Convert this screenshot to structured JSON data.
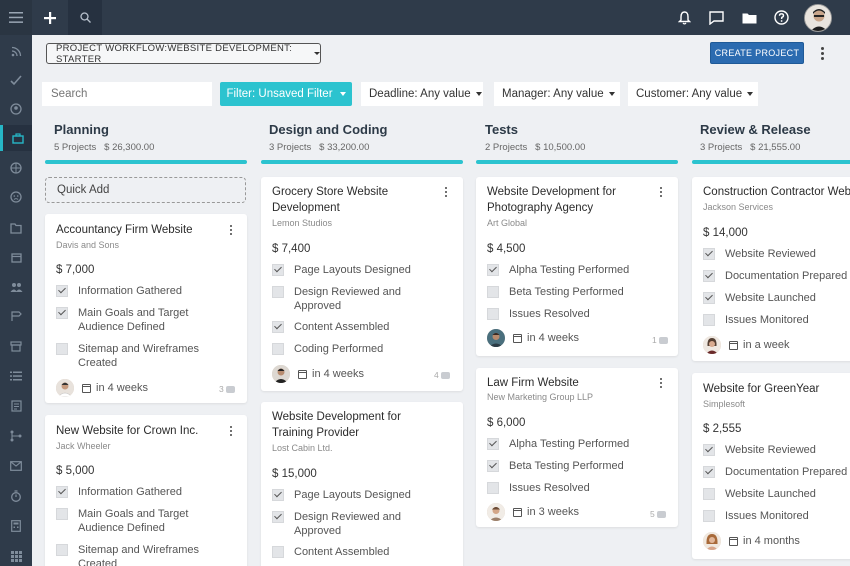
{
  "header": {
    "icons": [
      "hamburger-menu-icon",
      "plus-icon",
      "search-icon",
      "bell-icon",
      "chat-icon",
      "folder-icon",
      "help-icon",
      "user-avatar"
    ]
  },
  "sidebar": {
    "icons": [
      "feed-icon",
      "tasks-icon",
      "contacts-icon",
      "projects-icon",
      "globe-icon",
      "emoji-icon",
      "files-icon",
      "calendar-icon",
      "team-icon",
      "timeline-icon",
      "archive-icon",
      "list-icon",
      "reports-icon",
      "workflow-icon",
      "mail-icon",
      "timer-icon",
      "calculator-icon",
      "apps-icon"
    ],
    "active_index": 3
  },
  "toolbar": {
    "workflow_label": "PROJECT WORKFLOW:WEBSITE DEVELOPMENT: STARTER",
    "create_label": "CREATE PROJECT"
  },
  "filters": {
    "search_placeholder": "Search",
    "filter_label": "Filter: Unsaved Filter",
    "deadline": "Deadline: Any value",
    "manager": "Manager: Any value",
    "customer": "Customer: Any value"
  },
  "quick_add": "Quick Add",
  "columns": [
    {
      "title": "Planning",
      "count": "5 Projects",
      "amount": "$ 26,300.00",
      "cards": [
        {
          "title": "Accountancy Firm Website",
          "customer": "Davis and Sons",
          "price": "$ 7,000",
          "tasks": [
            {
              "label": "Information Gathered",
              "checked": true
            },
            {
              "label": "Main Goals and Target\nAudience Defined",
              "checked": true
            },
            {
              "label": "Sitemap and Wireframes\nCreated",
              "checked": false
            }
          ],
          "due": "in 4 weeks",
          "comments": "3"
        },
        {
          "title": "New Website for Crown Inc.",
          "customer": "Jack Wheeler",
          "price": "$ 5,000",
          "tasks": [
            {
              "label": "Information Gathered",
              "checked": true
            },
            {
              "label": "Main Goals and Target\nAudience Defined",
              "checked": false
            },
            {
              "label": "Sitemap and Wireframes\nCreated",
              "checked": false
            }
          ]
        }
      ]
    },
    {
      "title": "Design and Coding",
      "count": "3 Projects",
      "amount": "$ 33,200.00",
      "cards": [
        {
          "title": "Grocery Store Website\nDevelopment",
          "customer": "Lemon Studios",
          "price": "$ 7,400",
          "tasks": [
            {
              "label": "Page Layouts Designed",
              "checked": true
            },
            {
              "label": "Design Reviewed and\nApproved",
              "checked": false
            },
            {
              "label": "Content Assembled",
              "checked": true
            },
            {
              "label": "Coding Performed",
              "checked": false
            }
          ],
          "due": "in 4 weeks",
          "comments": "4"
        },
        {
          "title": "Website Development for\nTraining Provider",
          "customer": "Lost Cabin Ltd.",
          "price": "$ 15,000",
          "tasks": [
            {
              "label": "Page Layouts Designed",
              "checked": true
            },
            {
              "label": "Design Reviewed and\nApproved",
              "checked": true
            },
            {
              "label": "Content Assembled",
              "checked": false
            }
          ]
        }
      ]
    },
    {
      "title": "Tests",
      "count": "2 Projects",
      "amount": "$ 10,500.00",
      "cards": [
        {
          "title": "Website Development for\nPhotography Agency",
          "customer": "Art Global",
          "price": "$ 4,500",
          "tasks": [
            {
              "label": "Alpha Testing Performed",
              "checked": true
            },
            {
              "label": "Beta Testing Performed",
              "checked": false
            },
            {
              "label": "Issues Resolved",
              "checked": false
            }
          ],
          "due": "in 4 weeks",
          "comments": "1"
        },
        {
          "title": "Law Firm Website",
          "customer": "New Marketing Group LLP",
          "price": "$ 6,000",
          "tasks": [
            {
              "label": "Alpha Testing Performed",
              "checked": true
            },
            {
              "label": "Beta Testing Performed",
              "checked": true
            },
            {
              "label": "Issues Resolved",
              "checked": false
            }
          ],
          "due": "in 3 weeks",
          "comments": "5"
        }
      ]
    },
    {
      "title": "Review & Release",
      "count": "3 Projects",
      "amount": "$ 21,555.00",
      "cards": [
        {
          "title": "Construction Contractor Website",
          "customer": "Jackson Services",
          "price": "$ 14,000",
          "tasks": [
            {
              "label": "Website Reviewed",
              "checked": true
            },
            {
              "label": "Documentation Prepared",
              "checked": true
            },
            {
              "label": "Website Launched",
              "checked": true
            },
            {
              "label": "Issues Monitored",
              "checked": false
            }
          ],
          "due": "in a week"
        },
        {
          "title": "Website for GreenYear",
          "customer": "Simplesoft",
          "price": "$ 2,555",
          "tasks": [
            {
              "label": "Website Reviewed",
              "checked": true
            },
            {
              "label": "Documentation Prepared",
              "checked": true
            },
            {
              "label": "Website Launched",
              "checked": false
            },
            {
              "label": "Issues Monitored",
              "checked": false
            }
          ],
          "due": "in 4 months"
        }
      ]
    }
  ],
  "colors": {
    "topbar": "#2f3b4a",
    "accent": "#2cc3cf",
    "primary_button": "#2b6bb0"
  }
}
